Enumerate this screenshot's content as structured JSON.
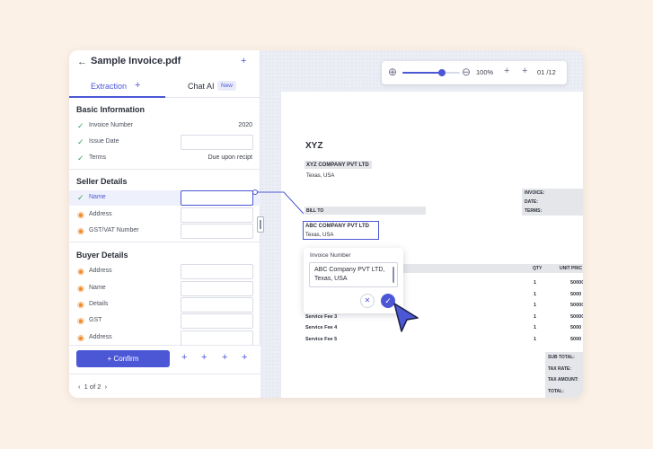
{
  "panel": {
    "title": "Sample Invoice.pdf",
    "tabs": {
      "extraction": "Extraction",
      "chat": "Chat AI",
      "chat_badge": "New"
    },
    "basic": {
      "title": "Basic Information",
      "rows": [
        {
          "label": "Invoice Number",
          "value": "2020"
        },
        {
          "label": "Issue Date"
        },
        {
          "label": "Terms",
          "value": "Due upon recipt"
        }
      ]
    },
    "seller": {
      "title": "Seller Details",
      "rows": [
        {
          "label": "Name"
        },
        {
          "label": "Address"
        },
        {
          "label": "GST/VAT Number"
        }
      ]
    },
    "buyer": {
      "title": "Buyer Details",
      "rows": [
        {
          "label": "Address"
        },
        {
          "label": "Name"
        },
        {
          "label": "Details"
        },
        {
          "label": "GST"
        },
        {
          "label": "Address"
        }
      ]
    },
    "confirm_label": "Confirm",
    "pager": "1 of 2"
  },
  "toolbar": {
    "zoom": "100%",
    "page": "01 /12",
    "zoom_level": 0.68
  },
  "document": {
    "title": "XYZ",
    "company": "XYZ COMPANY PVT LTD",
    "company_location": "Texas, USA",
    "invoice_fields": [
      "INVOICE:",
      "DATE:",
      "TERMS:"
    ],
    "bill_to": "BILL TO",
    "buyer_name": "ABC COMPANY PVT LTD",
    "buyer_location": "Texas, USA",
    "table_headers": [
      "QTY",
      "UNIT PRIC"
    ],
    "lines": [
      {
        "service": "",
        "qty": "1",
        "price": "50000"
      },
      {
        "service": "",
        "qty": "1",
        "price": "5000"
      },
      {
        "service": "",
        "qty": "1",
        "price": "50000"
      },
      {
        "service": "Service Fee 3",
        "qty": "1",
        "price": "50000"
      },
      {
        "service": "Service Fee 4",
        "qty": "1",
        "price": "5000"
      },
      {
        "service": "Service Fee 5",
        "qty": "1",
        "price": "5000"
      }
    ],
    "totals": [
      "SUB TOTAL:",
      "TAX RATE:",
      "TAX AMOUNT:",
      "TOTAL:"
    ]
  },
  "popup": {
    "label": "Invoice Number",
    "value": "ABC Company PVT LTD, Texas, USA"
  },
  "colors": {
    "accent": "#4c57d6",
    "check": "#3aa55b",
    "warning": "#f08c2e",
    "background": "#fcf1e6"
  }
}
